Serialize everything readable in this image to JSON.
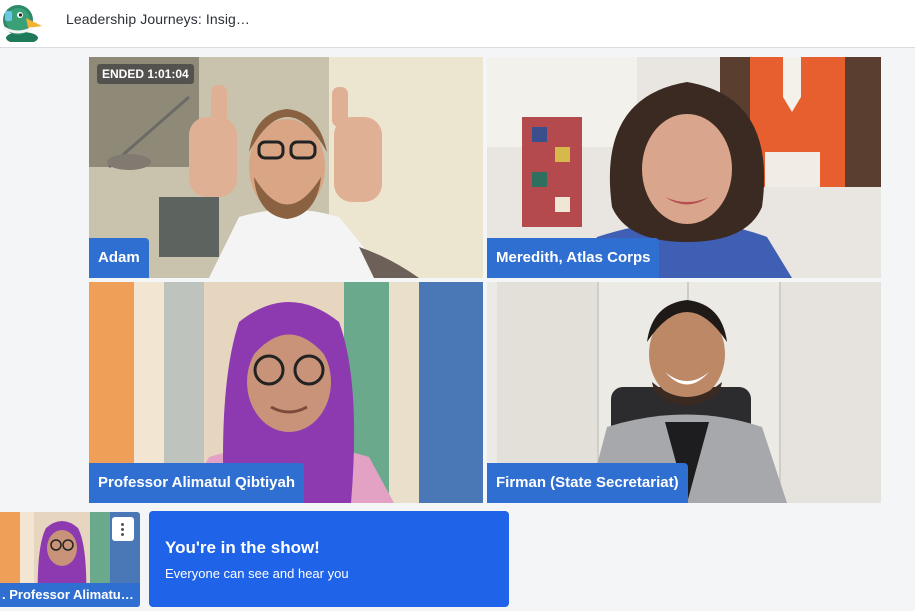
{
  "header": {
    "title": "Leadership Journeys: Insig…"
  },
  "recording": {
    "status": "ENDED 1:01:04"
  },
  "participants": [
    {
      "name": "Adam"
    },
    {
      "name": "Meredith, Atlas Corps"
    },
    {
      "name": "Professor Alimatul Qibtiyah"
    },
    {
      "name": "Firman (State Secretariat)"
    }
  ],
  "self_view": {
    "name": ". Professor Alimatu…",
    "menu_icon": "kebab-menu-icon"
  },
  "notification": {
    "title": "You're in the show!",
    "subtitle": "Everyone can see and hear you"
  },
  "colors": {
    "accent": "#2f6fd1",
    "toast": "#1f63e8"
  }
}
